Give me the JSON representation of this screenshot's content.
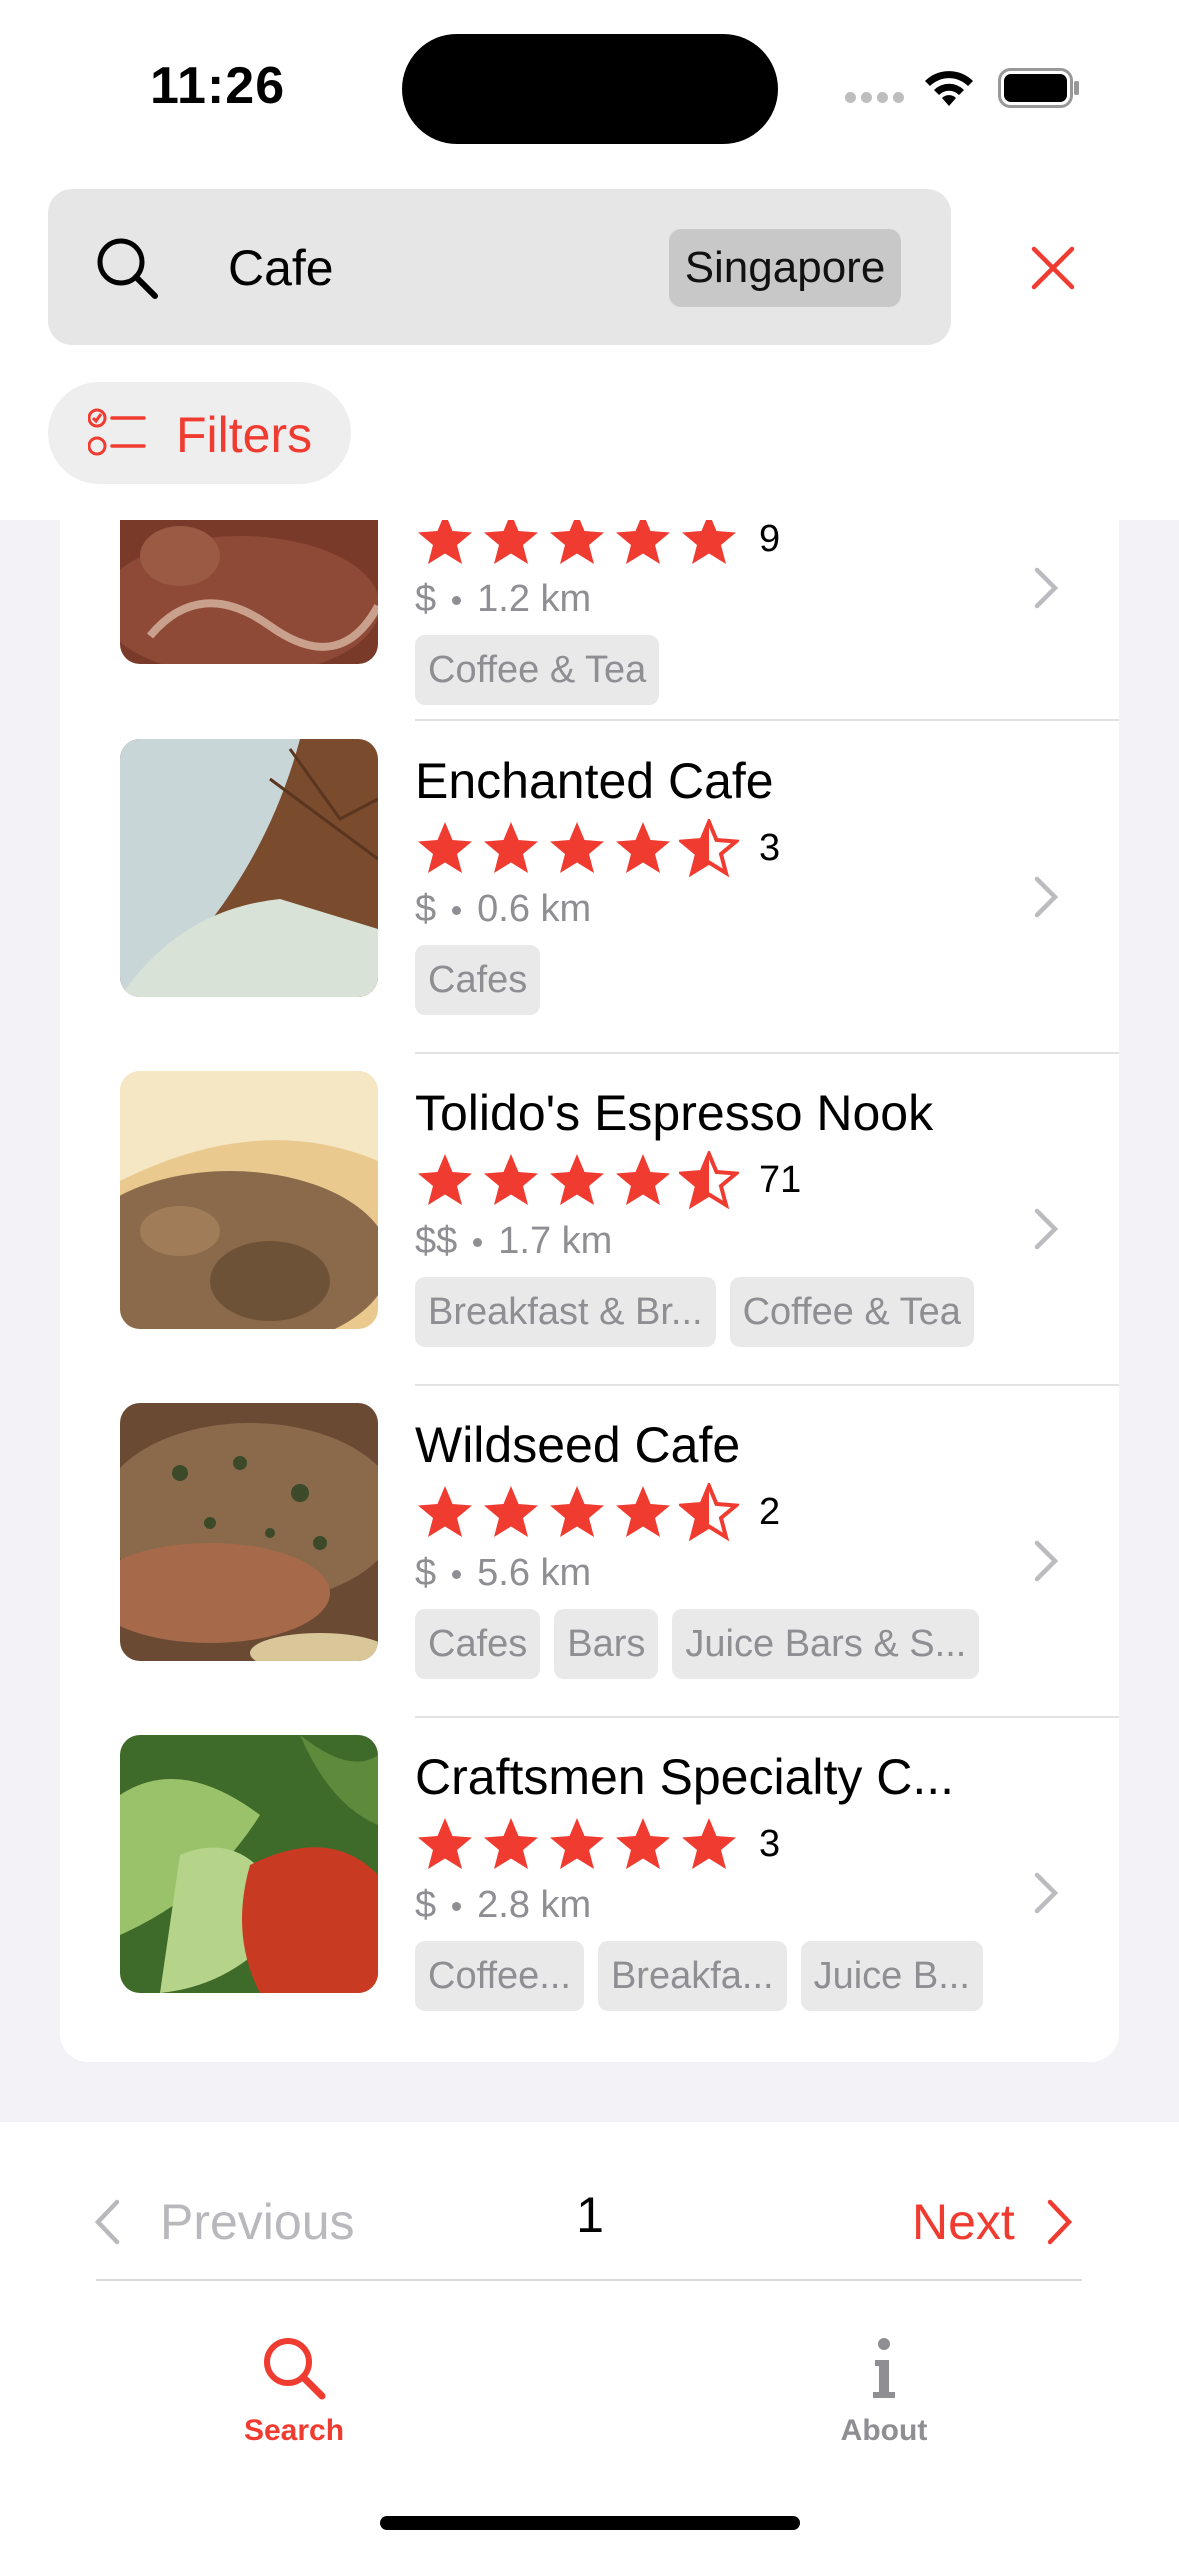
{
  "status_bar": {
    "time": "11:26"
  },
  "search": {
    "query": "Cafe",
    "location": "Singapore"
  },
  "filters": {
    "label": "Filters"
  },
  "colors": {
    "accent": "#f03b30",
    "muted": "#8e8e93",
    "tag_bg": "#e9e9ea"
  },
  "results": [
    {
      "title": "",
      "rating": 5,
      "review_count": "9",
      "price": "$",
      "distance": "1.2 km",
      "tags": [
        "Coffee & Tea"
      ]
    },
    {
      "title": "Enchanted Cafe",
      "rating": 4.5,
      "review_count": "3",
      "price": "$",
      "distance": "0.6 km",
      "tags": [
        "Cafes"
      ]
    },
    {
      "title": "Tolido's Espresso Nook",
      "rating": 4.5,
      "review_count": "71",
      "price": "$$",
      "distance": "1.7 km",
      "tags": [
        "Breakfast & Br...",
        "Coffee & Tea"
      ]
    },
    {
      "title": "Wildseed Cafe",
      "rating": 4.5,
      "review_count": "2",
      "price": "$",
      "distance": "5.6 km",
      "tags": [
        "Cafes",
        "Bars",
        "Juice Bars & S..."
      ]
    },
    {
      "title": "Craftsmen Specialty C...",
      "rating": 5,
      "review_count": "3",
      "price": "$",
      "distance": "2.8 km",
      "tags": [
        "Coffee...",
        "Breakfa...",
        "Juice B..."
      ]
    }
  ],
  "pagination": {
    "previous_label": "Previous",
    "page": "1",
    "next_label": "Next"
  },
  "tab_bar": {
    "tabs": [
      {
        "label": "Search",
        "icon": "search-icon",
        "active": true
      },
      {
        "label": "About",
        "icon": "info-icon",
        "active": false
      }
    ]
  }
}
